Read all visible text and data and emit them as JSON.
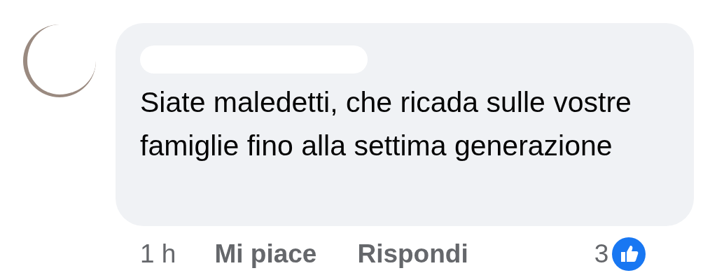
{
  "comment": {
    "author_redacted": true,
    "text": "Siate maledetti, che ricada sulle vostre famiglie fino alla settima generazione"
  },
  "actions": {
    "time": "1 h",
    "like": "Mi piace",
    "reply": "Rispondi",
    "reaction_count": "3"
  }
}
